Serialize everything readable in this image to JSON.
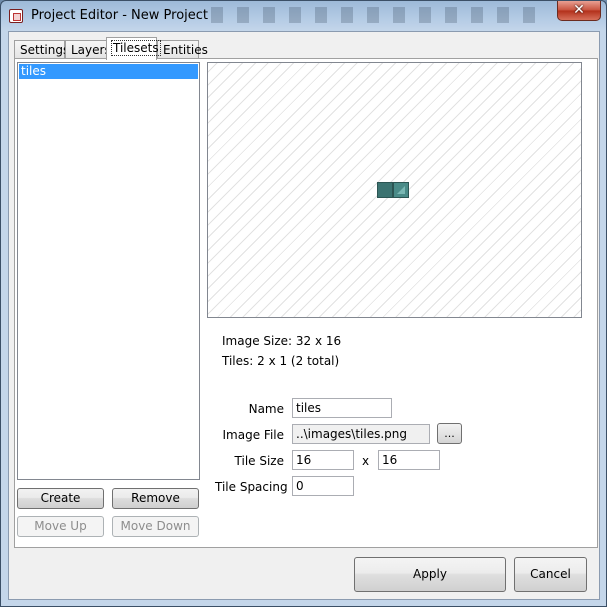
{
  "window": {
    "title": "Project Editor - New Project",
    "close_glyph": "✕"
  },
  "tabs": [
    {
      "label": "Settings",
      "active": false
    },
    {
      "label": "Layers",
      "active": false
    },
    {
      "label": "Tilesets",
      "active": true
    },
    {
      "label": "Entities",
      "active": false
    }
  ],
  "tileset_list": {
    "items": [
      {
        "label": "tiles",
        "selected": true
      }
    ]
  },
  "list_buttons": {
    "create": "Create",
    "remove": "Remove",
    "move_up": "Move Up",
    "move_down": "Move Down"
  },
  "preview": {
    "tile_columns": 2,
    "tile_rows": 1,
    "colors": {
      "tile_dark": "#3c7371",
      "tile_light": "#4a8b88"
    }
  },
  "info": {
    "image_size": "Image Size: 32 x 16",
    "tiles": "Tiles: 2 x 1 (2 total)"
  },
  "form": {
    "name_label": "Name",
    "name_value": "tiles",
    "image_file_label": "Image File",
    "image_file_value": "..\\images\\tiles.png",
    "browse_label": "...",
    "tile_size_label": "Tile Size",
    "tile_width": "16",
    "tile_size_sep": "x",
    "tile_height": "16",
    "tile_spacing_label": "Tile Spacing",
    "tile_spacing_value": "0"
  },
  "footer": {
    "apply": "Apply",
    "cancel": "Cancel"
  },
  "colors": {
    "selection": "#3399ff",
    "close_button": "#c7503b"
  }
}
